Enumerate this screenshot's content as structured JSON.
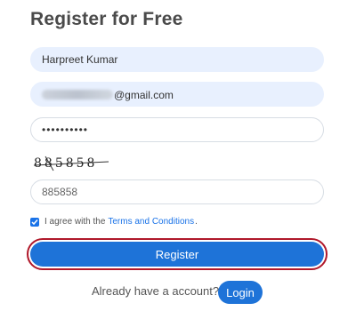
{
  "form": {
    "title": "Register for Free",
    "name_value": "Harpreet Kumar",
    "email_visible_domain": "@gmail.com",
    "password_mask": "••••••••••",
    "captcha_text": "885858",
    "captcha_input_value": "885858",
    "agree_prefix": "I agree with the",
    "agree_link": "Terms and Conditions",
    "agree_suffix": ".",
    "agree_checked": true,
    "register_label": "Register",
    "already_text": "Already have a account?",
    "login_label": "Login"
  },
  "colors": {
    "accent": "#1e73d8",
    "highlight_ring": "#b0182a",
    "filled_bg": "#e8f0fe"
  },
  "icons": {
    "checkbox": "checkmark-icon"
  }
}
